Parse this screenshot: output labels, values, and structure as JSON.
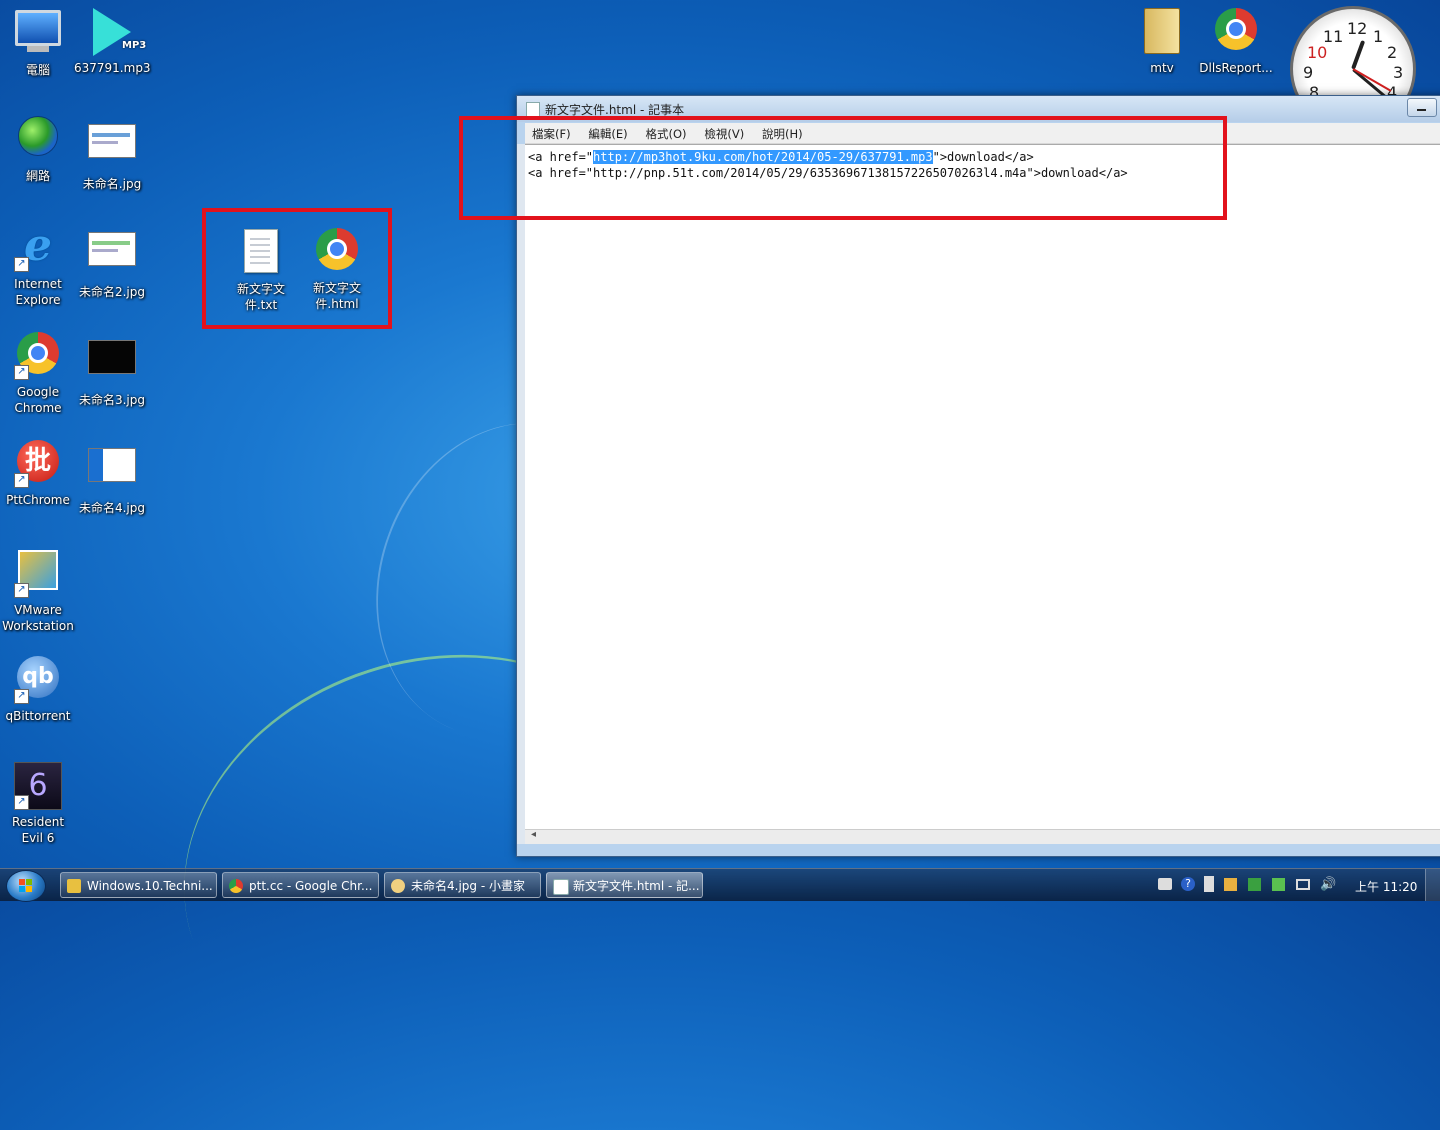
{
  "desktop": {
    "icons": [
      {
        "label": "電腦"
      },
      {
        "label": "637791.mp3"
      },
      {
        "label": "網路"
      },
      {
        "label": "未命名.jpg"
      },
      {
        "label": "Internet Explore"
      },
      {
        "label": "未命名2.jpg"
      },
      {
        "label": "Google Chrome"
      },
      {
        "label": "未命名3.jpg"
      },
      {
        "label": "PttChrome"
      },
      {
        "label": "未命名4.jpg"
      },
      {
        "label": "VMware Workstation"
      },
      {
        "label": "qBittorrent"
      },
      {
        "label": "Resident Evil 6"
      },
      {
        "label": "新文字文件.txt"
      },
      {
        "label": "新文字文件.html"
      },
      {
        "label": "mtv"
      },
      {
        "label": "DllsReport..."
      }
    ],
    "mp3_badge": "MP3",
    "pitt_glyph": "批",
    "qb_glyph": "qb",
    "highlight_color": "#e2121c"
  },
  "clock_gadget": {
    "numbers": [
      "12",
      "1",
      "2",
      "3",
      "4",
      "11",
      "10",
      "9",
      "8"
    ]
  },
  "notepad": {
    "title": "新文字文件.html - 記事本",
    "menu": [
      "檔案(F)",
      "編輯(E)",
      "格式(O)",
      "檢視(V)",
      "說明(H)"
    ],
    "lines": [
      {
        "before": "<a href=\"",
        "selected": "http://mp3hot.9ku.com/hot/2014/05-29/637791.mp3",
        "after": "\">download</a>"
      },
      {
        "before": "<a href=\"http://pnp.51t.com/2014/05/29/635369671381572265070263l4.m4a\">download</a>",
        "selected": "",
        "after": ""
      }
    ],
    "selection_color": "#3399ff"
  },
  "taskbar": {
    "buttons": [
      {
        "label": "Windows.10.Techni..."
      },
      {
        "label": "ptt.cc - Google Chr..."
      },
      {
        "label": "未命名4.jpg - 小畫家"
      },
      {
        "label": "新文字文件.html - 記..."
      }
    ],
    "clock": "上午 11:20"
  }
}
